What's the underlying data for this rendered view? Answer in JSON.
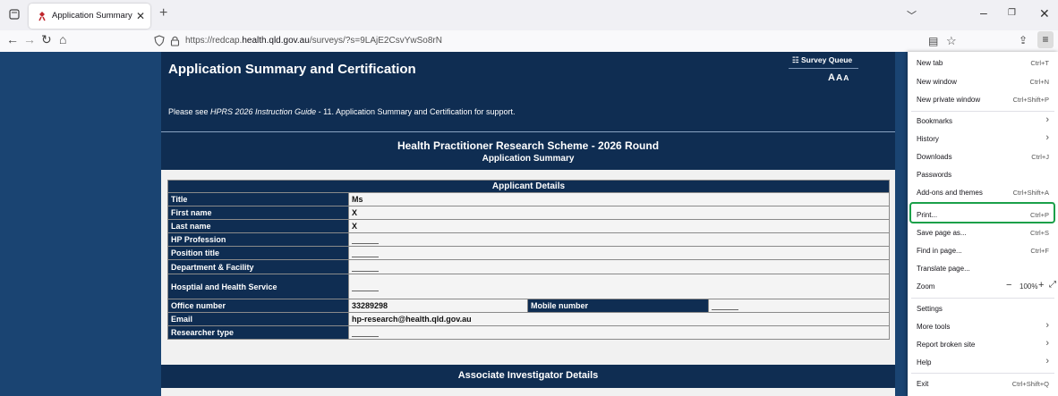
{
  "browser": {
    "tab_title": "Application Summary and Certification",
    "url_host_prefix": "https://redcap.",
    "url_host": "health.qld.gov.au",
    "url_path": "/surveys/?s=9LAjE2CsvYwSo8rN"
  },
  "page": {
    "title": "Application Summary and Certification",
    "survey_queue_label": "Survey Queue",
    "font_size_controls": [
      "A",
      "A",
      "A"
    ],
    "support_prefix": "Please see ",
    "support_link": "HPRS 2026 Instruction Guide",
    "support_suffix": " - 11. Application Summary and Certification for support.",
    "scheme_title": "Health Practitioner Research Scheme - 2026 Round",
    "scheme_subtitle": "Application Summary",
    "applicant_header": "Applicant Details",
    "fields": {
      "title_label": "Title",
      "title_value": "Ms",
      "first_name_label": "First name",
      "first_name_value": "X",
      "last_name_label": "Last name",
      "last_name_value": "X",
      "hp_profession_label": "HP Profession",
      "position_title_label": "Position title",
      "department_label": "Department & Facility",
      "hhs_label": "Hosptial and Health Service",
      "office_number_label": "Office number",
      "office_number_value": "33289298",
      "mobile_number_label": "Mobile number",
      "email_label": "Email",
      "email_value": "hp-research@health.qld.gov.au",
      "researcher_type_label": "Researcher type"
    },
    "associate_header": "Associate Investigator Details"
  },
  "menu": {
    "new_tab": "New tab",
    "new_tab_key": "Ctrl+T",
    "new_window": "New window",
    "new_window_key": "Ctrl+N",
    "private_window": "New private window",
    "private_window_key": "Ctrl+Shift+P",
    "bookmarks": "Bookmarks",
    "history": "History",
    "downloads": "Downloads",
    "downloads_key": "Ctrl+J",
    "passwords": "Passwords",
    "addons": "Add-ons and themes",
    "addons_key": "Ctrl+Shift+A",
    "print": "Print...",
    "print_key": "Ctrl+P",
    "save_page": "Save page as...",
    "save_page_key": "Ctrl+S",
    "find": "Find in page...",
    "find_key": "Ctrl+F",
    "translate": "Translate page...",
    "zoom": "Zoom",
    "zoom_value": "100%",
    "settings": "Settings",
    "more_tools": "More tools",
    "report": "Report broken site",
    "help": "Help",
    "exit": "Exit",
    "exit_key": "Ctrl+Shift+Q"
  }
}
